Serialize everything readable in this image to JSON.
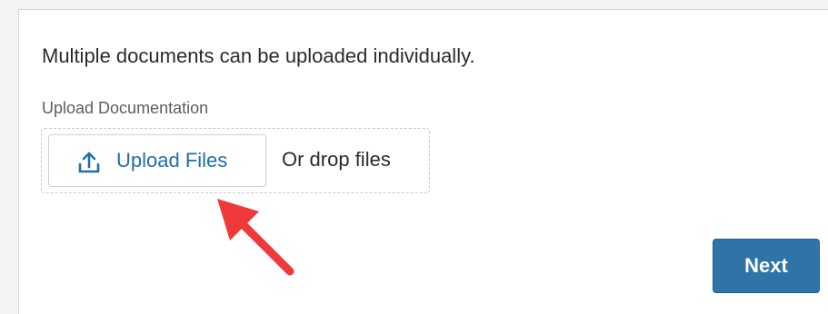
{
  "form": {
    "intro_text": "Multiple documents can be uploaded individually.",
    "field_label": "Upload Documentation",
    "upload_button_label": "Upload Files",
    "drop_text": "Or drop files",
    "next_button_label": "Next"
  },
  "icons": {
    "upload": "upload-icon",
    "annotation": "red-arrow-icon"
  },
  "colors": {
    "accent": "#1f6fa5",
    "primary_button": "#2f74a8",
    "annotation_arrow": "#ee3a3a"
  }
}
